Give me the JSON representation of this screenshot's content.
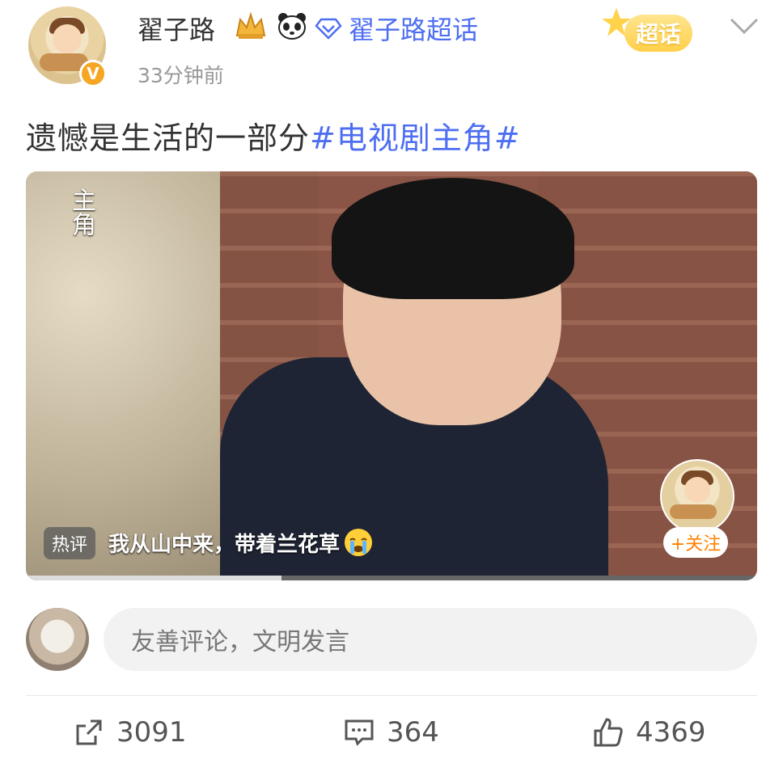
{
  "author": {
    "name": "翟子路",
    "timestamp": "33分钟前",
    "verified_mark": "V",
    "chaohua_link": "翟子路超话",
    "chaohua_badge": "超话"
  },
  "post": {
    "text": "遗憾是生活的一部分",
    "hashtag": "#电视剧主角#"
  },
  "video": {
    "watermark": "主角",
    "hot_comment_tag": "热评",
    "hot_comment_text": "我从山中来，带着兰花草",
    "follow_label": "+关注",
    "progress": 0.35
  },
  "comment_box": {
    "placeholder": "友善评论，文明发言"
  },
  "actions": {
    "repost_count": "3091",
    "comment_count": "364",
    "like_count": "4369"
  },
  "colors": {
    "link_blue": "#4e6ef2",
    "badge_orange": "#f6a623",
    "follow_orange": "#ff8200"
  }
}
